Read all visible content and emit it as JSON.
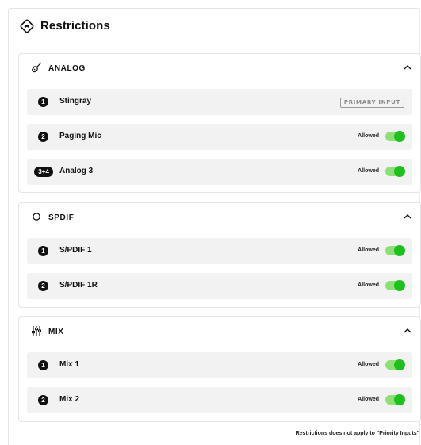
{
  "header": {
    "title": "Restrictions",
    "icon": "restrictions-icon"
  },
  "groups": [
    {
      "title": "ANALOG",
      "icon": "guitar-icon",
      "rows": [
        {
          "badge": "1",
          "label": "Stingray",
          "tag": "PRIMARY INPUT"
        },
        {
          "badge": "2",
          "label": "Paging Mic",
          "status": "Allowed",
          "enabled": true
        },
        {
          "badge": "3+4",
          "label": "Analog 3",
          "status": "Allowed",
          "enabled": true
        }
      ]
    },
    {
      "title": "SPDIF",
      "icon": "circle-icon",
      "rows": [
        {
          "badge": "1",
          "label": "S/PDIF 1",
          "status": "Allowed",
          "enabled": true
        },
        {
          "badge": "2",
          "label": "S/PDIF 1R",
          "status": "Allowed",
          "enabled": true
        }
      ]
    },
    {
      "title": "MIX",
      "icon": "mixer-sliders-icon",
      "rows": [
        {
          "badge": "1",
          "label": "Mix 1",
          "status": "Allowed",
          "enabled": true
        },
        {
          "badge": "2",
          "label": "Mix 2",
          "status": "Allowed",
          "enabled": true
        }
      ]
    }
  ],
  "footer_note": "Restrictions does not apply to \"Priority Inputs\"",
  "colors": {
    "toggle_track": "#8fde78",
    "toggle_knob": "#1dc01d",
    "row_bg": "#f2f2f2"
  }
}
